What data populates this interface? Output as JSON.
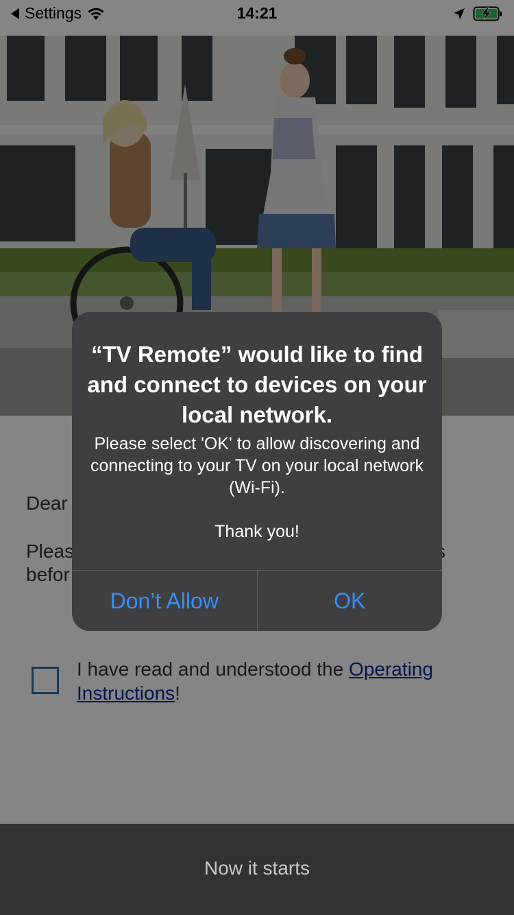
{
  "status_bar": {
    "back_label": "Settings",
    "time": "14:21",
    "icons": [
      "back-triangle-icon",
      "wifi-icon",
      "location-arrow-icon",
      "battery-charging-icon"
    ]
  },
  "content": {
    "greeting_fragment": "Dear",
    "line_please": "Pleas",
    "line_before": "befor",
    "line_trailing": "s"
  },
  "consent": {
    "text_prefix": "I have read and understood the ",
    "link_part1": "Operating",
    "link_part2": "Instructions",
    "text_suffix": "!",
    "checked": false
  },
  "bottom_button": {
    "label": "Now it starts"
  },
  "alert": {
    "title": "“TV Remote” would like to find and connect to devices on your local network.",
    "message": "Please select 'OK' to allow discovering and connecting to your TV on your local network (Wi-Fi).",
    "thanks": "Thank you!",
    "deny_label": "Don’t Allow",
    "ok_label": "OK"
  },
  "colors": {
    "alert_bg": "#3f3f41",
    "alert_button_text": "#3a8df5",
    "checkbox_border": "#2b6fb0",
    "link": "#0a2a9c",
    "bottom_bar": "#606060"
  }
}
